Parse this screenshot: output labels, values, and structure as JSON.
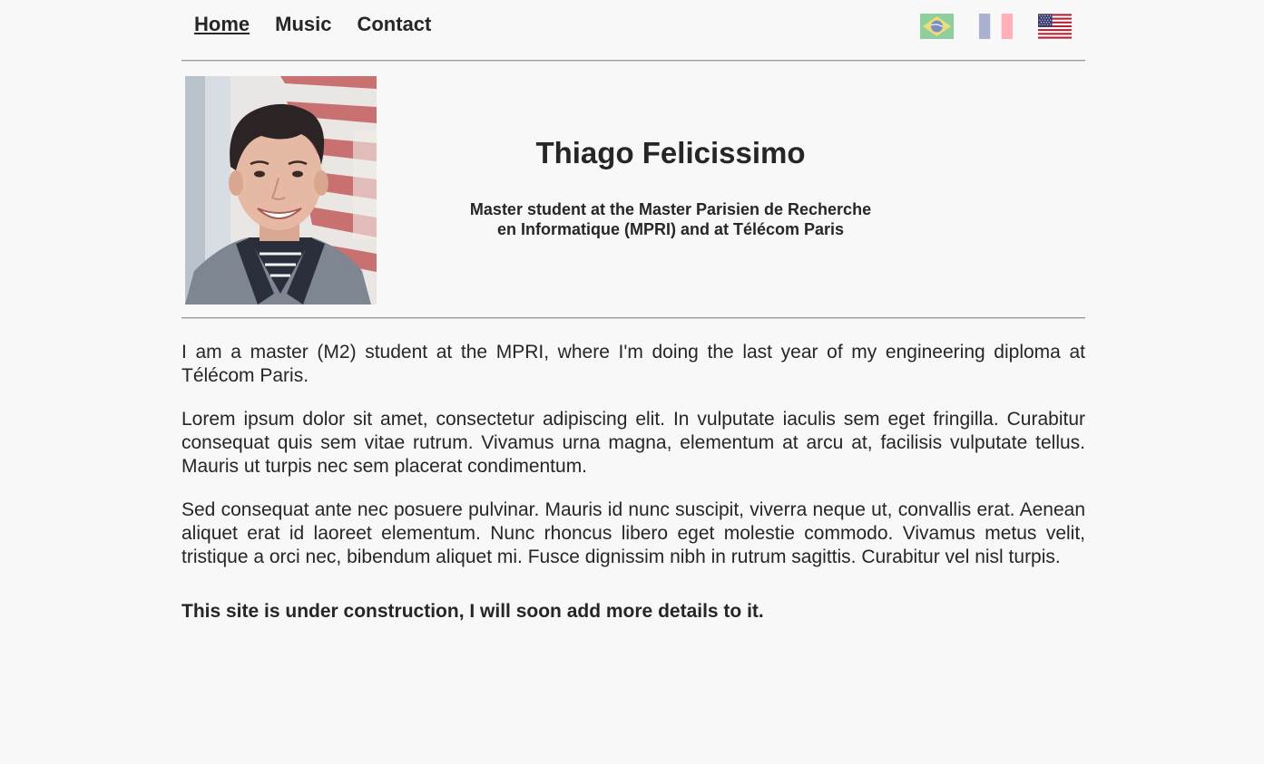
{
  "nav": {
    "items": [
      {
        "label": "Home",
        "active": true
      },
      {
        "label": "Music",
        "active": false
      },
      {
        "label": "Contact",
        "active": false
      }
    ],
    "languages": [
      {
        "icon": "brazil-flag-icon",
        "colors": [
          "#8fcf9e",
          "#ecdc7a",
          "#7a8ec4"
        ]
      },
      {
        "icon": "france-flag-icon",
        "colors": [
          "#aab0cf",
          "#ffffff",
          "#ffb0b8"
        ]
      },
      {
        "icon": "usa-flag-icon",
        "colors": [
          "#3c3b6e",
          "#ffffff",
          "#b22234"
        ]
      }
    ]
  },
  "profile": {
    "photo_icon": "profile-photo",
    "name": "Thiago Felicissimo",
    "tagline_line1": "Master student at the Master Parisien de Recherche",
    "tagline_line2": "en Informatique (MPRI) and at Télécom Paris"
  },
  "content": {
    "paragraphs": [
      "I am a master (M2) student at the MPRI, where I'm doing the last year of my engineering diploma at Télécom Paris.",
      "Lorem ipsum dolor sit amet, consectetur adipiscing elit. In vulputate iaculis sem eget fringilla. Curabitur consequat quis sem vitae rutrum. Vivamus urna magna, elementum at arcu at, facilisis vulputate tellus. Mauris ut turpis nec sem placerat condimentum.",
      "Sed consequat ante nec posuere pulvinar. Mauris id nunc suscipit, viverra neque ut, convallis erat. Aenean aliquet erat id laoreet elementum. Nunc rhoncus libero eget molestie commodo. Vivamus metus velit, tristique a orci nec, bibendum aliquet mi. Fusce dignissim nibh in rutrum sagittis. Curabitur vel nisl turpis."
    ],
    "notice": "This site is under construction, I will soon add more details to it."
  }
}
